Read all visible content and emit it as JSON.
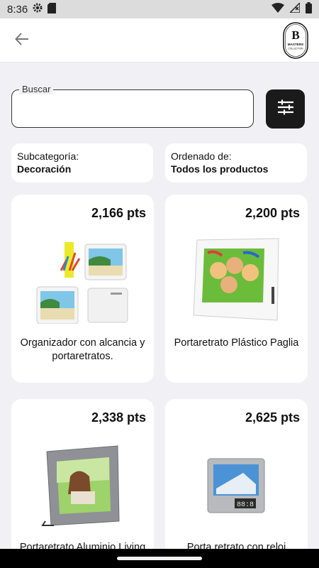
{
  "status_bar": {
    "time": "8:36",
    "icons": [
      "gear-icon",
      "sd-card-icon",
      "wifi-icon",
      "no-signal-icon",
      "battery-icon"
    ]
  },
  "app_bar": {
    "back_icon": "arrow-left-icon",
    "logo_letter": "B",
    "logo_line1": "MASTERS",
    "logo_line2": "COLLECTION"
  },
  "search": {
    "label": "Buscar",
    "value": "",
    "placeholder": ""
  },
  "filter_icon": "sliders-icon",
  "subcategory": {
    "label": "Subcategoría:",
    "value": "Decoración"
  },
  "order": {
    "label": "Ordenado de:",
    "value": "Todos los productos"
  },
  "products": [
    {
      "price": "2,166 pts",
      "name": "Organizador con alcancia y portaretratos."
    },
    {
      "price": "2,200 pts",
      "name": "Portaretrato Plástico Paglia"
    },
    {
      "price": "2,338 pts",
      "name": "Portaretrato Aluminio Living"
    },
    {
      "price": "2,625 pts",
      "name": "Porta retrato con reloj"
    }
  ],
  "colors": {
    "background": "#f1f0f5",
    "accent_dark": "#1a1a1a",
    "card": "#ffffff"
  }
}
